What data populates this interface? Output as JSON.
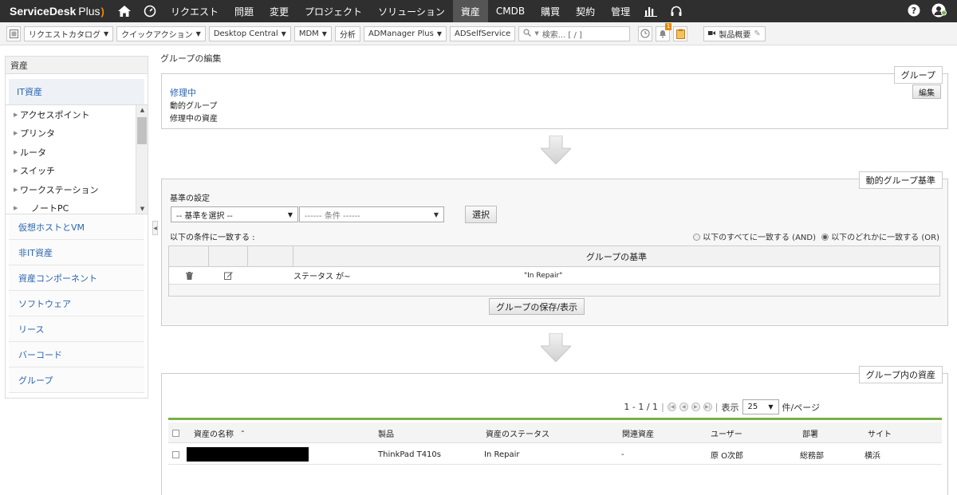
{
  "brand": {
    "name": "ServiceDesk",
    "plus": "Plus"
  },
  "nav": {
    "tabs": [
      "リクエスト",
      "問題",
      "変更",
      "プロジェクト",
      "ソリューション",
      "資産",
      "CMDB",
      "購買",
      "契約",
      "管理"
    ],
    "active_tab": "資産"
  },
  "toolbar": {
    "request_catalog": "リクエストカタログ",
    "quick_action": "クイックアクション",
    "desktop_central": "Desktop Central",
    "mdm": "MDM",
    "analysis": "分析",
    "admanager": "ADManager Plus",
    "adselfservice": "ADSelfService",
    "search_placeholder": "検索... [ / ]",
    "reminder_count": "1",
    "product_overview": "製品概要"
  },
  "sidebar": {
    "header": "資産",
    "it_assets": "IT資産",
    "tree": [
      {
        "label": "アクセスポイント"
      },
      {
        "label": "プリンタ"
      },
      {
        "label": "ルータ"
      },
      {
        "label": "スイッチ"
      },
      {
        "label": "ワークステーション"
      },
      {
        "label": "ノートPC"
      }
    ],
    "items": [
      "仮想ホストとVM",
      "非IT資産",
      "資産コンポーネント",
      "ソフトウェア",
      "リース",
      "バーコード",
      "グループ"
    ]
  },
  "page": {
    "title": "グループの編集"
  },
  "group_panel": {
    "legend": "グループ",
    "name": "修理中",
    "type": "動的グループ",
    "description": "修理中の資産",
    "edit_button": "編集"
  },
  "criteria_panel": {
    "legend": "動的グループ基準",
    "set_criteria_label": "基準の設定",
    "criteria_select": "-- 基準を選択 --",
    "condition_select": "------ 条件 ------",
    "select_button": "選択",
    "match_label": "以下の条件に一致する :",
    "match_all": "以下のすべてに一致する (AND)",
    "match_any": "以下のどれかに一致する (OR)",
    "selected_match": "any",
    "table_header": "グループの基準",
    "rows": [
      {
        "field": "ステータス が~",
        "value": "\"In Repair\""
      }
    ],
    "save_button": "グループの保存/表示"
  },
  "assets_panel": {
    "legend": "グループ内の資産",
    "pager_range": "1 - 1 / 1",
    "show_label": "表示",
    "per_page_value": "25",
    "per_page_suffix": "件/ページ",
    "columns": [
      "資産の名称",
      "製品",
      "資産のステータス",
      "関連資産",
      "ユーザー",
      "部署",
      "サイト"
    ],
    "rows": [
      {
        "name": "",
        "product": "ThinkPad T410s",
        "status": "In Repair",
        "related": "-",
        "user": "原 O次郎",
        "department": "総務部",
        "site": "横浜"
      }
    ]
  },
  "colors": {
    "nav_bg": "#2f2f2f",
    "link": "#2a64b0",
    "accent_green": "#7aaf48"
  }
}
